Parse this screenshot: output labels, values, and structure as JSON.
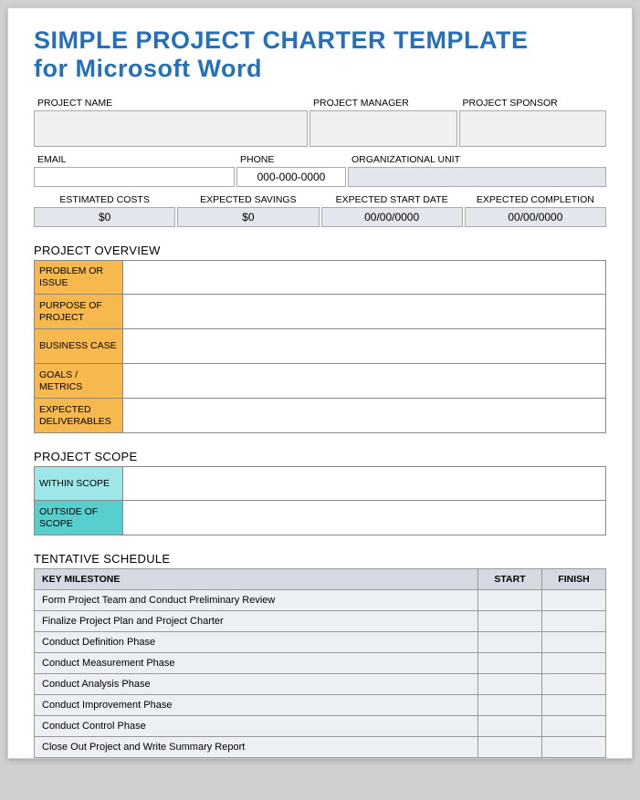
{
  "title_line1": "SIMPLE PROJECT CHARTER TEMPLATE",
  "title_line2": "for Microsoft Word",
  "top1": {
    "project_name_label": "PROJECT NAME",
    "project_manager_label": "PROJECT MANAGER",
    "project_sponsor_label": "PROJECT SPONSOR",
    "project_name": "",
    "project_manager": "",
    "project_sponsor": ""
  },
  "top2": {
    "email_label": "EMAIL",
    "phone_label": "PHONE",
    "org_unit_label": "ORGANIZATIONAL UNIT",
    "email": "",
    "phone": "000-000-0000",
    "org_unit": ""
  },
  "top3": {
    "est_costs_label": "ESTIMATED COSTS",
    "exp_savings_label": "EXPECTED SAVINGS",
    "exp_start_label": "EXPECTED START DATE",
    "exp_completion_label": "EXPECTED COMPLETION",
    "est_costs": "$0",
    "exp_savings": "$0",
    "exp_start": "00/00/0000",
    "exp_completion": "00/00/0000"
  },
  "overview": {
    "heading": "PROJECT OVERVIEW",
    "rows": [
      {
        "label": "PROBLEM OR ISSUE",
        "value": ""
      },
      {
        "label": "PURPOSE OF PROJECT",
        "value": ""
      },
      {
        "label": "BUSINESS CASE",
        "value": ""
      },
      {
        "label": "GOALS / METRICS",
        "value": ""
      },
      {
        "label": "EXPECTED DELIVERABLES",
        "value": ""
      }
    ]
  },
  "scope": {
    "heading": "PROJECT SCOPE",
    "rows": [
      {
        "label": "WITHIN SCOPE",
        "value": ""
      },
      {
        "label": "OUTSIDE OF SCOPE",
        "value": ""
      }
    ]
  },
  "schedule": {
    "heading": "TENTATIVE SCHEDULE",
    "col_milestone": "KEY MILESTONE",
    "col_start": "START",
    "col_finish": "FINISH",
    "rows": [
      {
        "milestone": "Form Project Team and Conduct Preliminary Review",
        "start": "",
        "finish": ""
      },
      {
        "milestone": "Finalize Project Plan and Project Charter",
        "start": "",
        "finish": ""
      },
      {
        "milestone": "Conduct Definition Phase",
        "start": "",
        "finish": ""
      },
      {
        "milestone": "Conduct Measurement Phase",
        "start": "",
        "finish": ""
      },
      {
        "milestone": "Conduct Analysis Phase",
        "start": "",
        "finish": ""
      },
      {
        "milestone": "Conduct Improvement Phase",
        "start": "",
        "finish": ""
      },
      {
        "milestone": "Conduct Control Phase",
        "start": "",
        "finish": ""
      },
      {
        "milestone": "Close Out Project and Write Summary Report",
        "start": "",
        "finish": ""
      }
    ]
  }
}
